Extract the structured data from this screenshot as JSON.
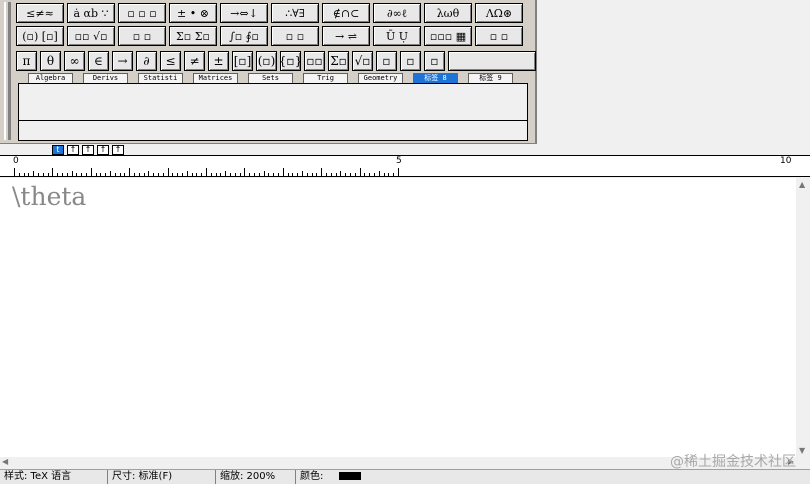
{
  "toolbar": {
    "row1": [
      "≤≠≈",
      "ȧ αb ∵",
      "▫ ▫ ▫",
      "± • ⊗",
      "→⇔↓",
      "∴∀∃",
      "∉∩⊂",
      "∂∞ℓ",
      "λωθ",
      "ΛΩ⊛"
    ],
    "row2": [
      "(▫) [▫]",
      "▫▫ √▫",
      "▫ ▫",
      "Σ▫ Σ▫",
      "∫▫ ∮▫",
      "▫ ▫",
      "→ ⇌",
      "Ū Ụ",
      "▫▫▫ ▦",
      "▫ ▫"
    ],
    "row3": [
      "π",
      "θ",
      "∞",
      "∈",
      "→",
      "∂",
      "≤",
      "≠",
      "±",
      "[▫]",
      "(▫)",
      "{▫}",
      "▫▫",
      "Σ▫",
      "√▫",
      "▫",
      "▫",
      "▫",
      ""
    ],
    "tabs": [
      "Algebra",
      "Derivs",
      "Statisti",
      "Matrices",
      "Sets",
      "Trig",
      "Geometry",
      "标签 8",
      "标签 9"
    ],
    "active_tab": "标签 8"
  },
  "ruler": {
    "tab_stops": [
      "t",
      "↑",
      "↑",
      "↑",
      "↑"
    ],
    "labels": [
      "0",
      "5",
      "10"
    ]
  },
  "editor": {
    "content": "\\theta"
  },
  "statusbar": {
    "style": "样式: TeX 语言",
    "size": "尺寸: 标准(F)",
    "zoom": "缩放: 200%",
    "color_label": "颜色:",
    "color_value": "#000000"
  },
  "watermark": "@稀土掘金技术社区"
}
